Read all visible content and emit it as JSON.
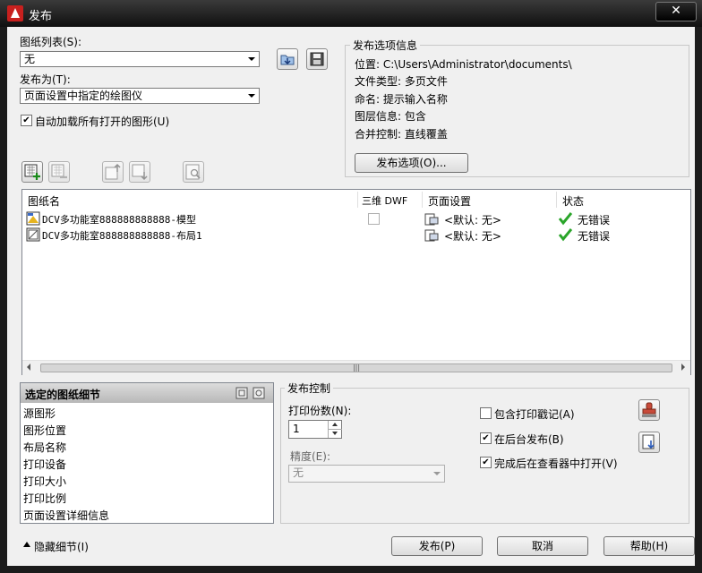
{
  "window": {
    "title": "发布",
    "close_glyph": "✕"
  },
  "sheet_list": {
    "label": "图纸列表(S):",
    "value": "无"
  },
  "publish_to": {
    "label": "发布为(T):",
    "value": "页面设置中指定的绘图仪"
  },
  "auto_load": {
    "label": "自动加载所有打开的图形(U)",
    "checked": true
  },
  "publish_options_info": {
    "title": "发布选项信息",
    "location": "位置: C:\\Users\\Administrator\\documents\\",
    "file_type": "文件类型: 多页文件",
    "naming": "命名: 提示输入名称",
    "layer_info": "图层信息: 包含",
    "merge_control": "合并控制: 直线覆盖",
    "button_label": "发布选项(O)..."
  },
  "toolbar_icons": [
    "add-sheets-icon",
    "remove-sheets-icon",
    "move-sheet-up-icon",
    "move-sheet-down-icon",
    "preview-icon",
    "load-sheet-list-icon",
    "save-sheet-list-icon"
  ],
  "sheet_table": {
    "columns": [
      "图纸名",
      "三维 DWF",
      "页面设置",
      "状态"
    ],
    "rows": [
      {
        "name": "DCV多功能室888888888888-模型",
        "page_setup": "<默认: 无>",
        "status": "无错误",
        "type": "model"
      },
      {
        "name": "DCV多功能室888888888888-布局1",
        "page_setup": "<默认: 无>",
        "status": "无错误",
        "type": "layout"
      }
    ]
  },
  "selected_details": {
    "title": "选定的图纸细节",
    "items": [
      "源图形",
      "图形位置",
      "布局名称",
      "打印设备",
      "打印大小",
      "打印比例",
      "页面设置详细信息"
    ]
  },
  "publish_control": {
    "title": "发布控制",
    "copies_label": "打印份数(N):",
    "copies_value": "1",
    "precision_label": "精度(E):",
    "precision_value": "无",
    "include_stamp": {
      "label": "包含打印戳记(A)",
      "checked": false
    },
    "background_publish": {
      "label": "在后台发布(B)",
      "checked": true
    },
    "open_viewer": {
      "label": "完成后在查看器中打开(V)",
      "checked": true
    }
  },
  "footer": {
    "hide_details": "隐藏细节(I)",
    "publish_button": "发布(P)",
    "cancel_button": "取消",
    "help_button": "帮助(H)"
  }
}
